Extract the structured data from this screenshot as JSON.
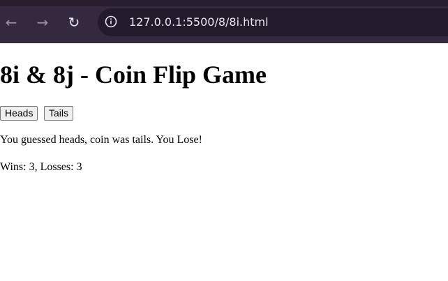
{
  "browser": {
    "url": "127.0.0.1:5500/8/8i.html",
    "icons": {
      "back": "back-arrow-icon",
      "forward": "forward-arrow-icon",
      "reload": "reload-icon",
      "info": "info-icon"
    }
  },
  "page": {
    "title": "8i & 8j - Coin Flip Game",
    "buttons": {
      "heads": "Heads",
      "tails": "Tails"
    },
    "result": "You guessed heads, coin was tails. You Lose!",
    "score": "Wins: 3, Losses: 3"
  }
}
